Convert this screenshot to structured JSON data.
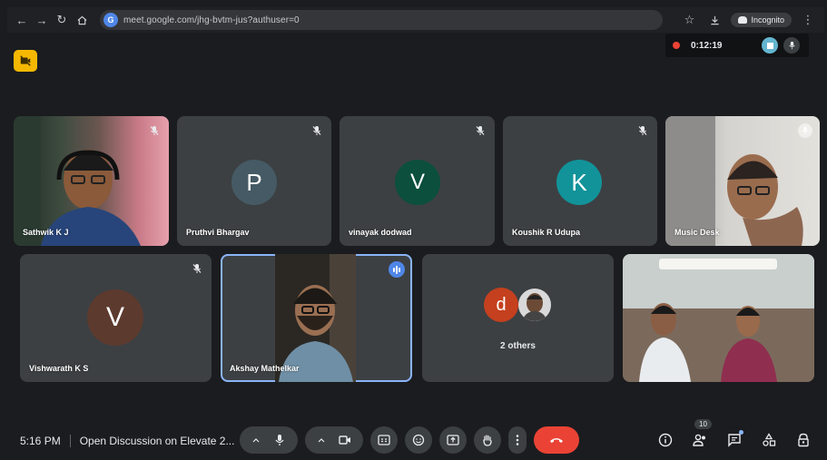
{
  "browser": {
    "url": "meet.google.com/jhg-bvtm-jus?authuser=0",
    "incognito_label": "Incognito"
  },
  "recording": {
    "time": "0:12:19"
  },
  "tiles": [
    {
      "name": "Sathwik K J",
      "type": "video"
    },
    {
      "name": "Pruthvi Bhargav",
      "initial": "P",
      "color": "#455a64"
    },
    {
      "name": "vinayak dodwad",
      "initial": "V",
      "color": "#0b4f3c"
    },
    {
      "name": "Koushik R Udupa",
      "initial": "K",
      "color": "#12939a"
    },
    {
      "name": "Music Desk",
      "type": "video"
    },
    {
      "name": "Vishwarath K S",
      "initial": "V",
      "color": "#5d3a2e"
    },
    {
      "name": "Akshay Mathelkar",
      "type": "video",
      "speaking": true
    },
    {
      "others_label": "2 others",
      "initial": "d",
      "color": "#c5401e"
    },
    {
      "type": "video"
    }
  ],
  "bottom_bar": {
    "time": "5:16 PM",
    "meeting_title": "Open Discussion on Elevate 2...",
    "people_count": "10"
  },
  "colors": {
    "leave": "#ea4335",
    "speaking_outline": "#8ab4f8",
    "cam_off_chip": "#f5b800"
  }
}
